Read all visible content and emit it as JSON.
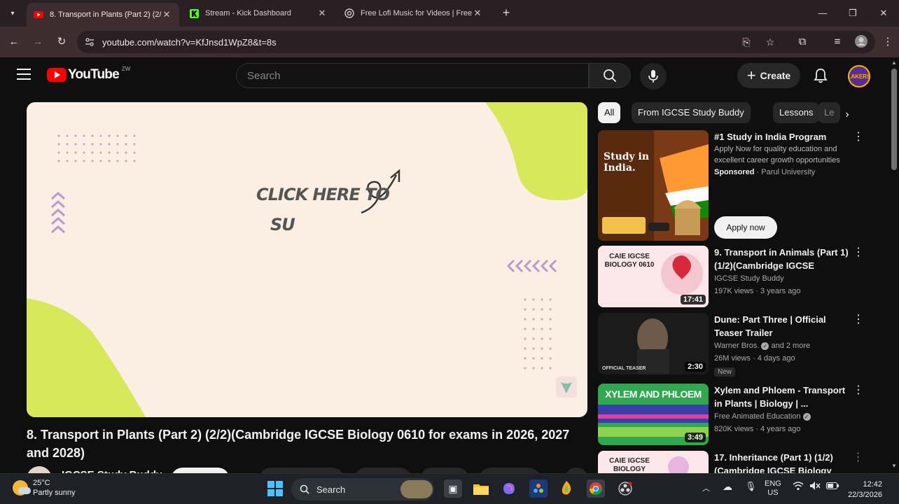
{
  "browser": {
    "tabs": [
      {
        "title": "8. Transport in Plants (Part 2) (2/2",
        "favicon": "youtube-icon",
        "active": true
      },
      {
        "title": "Stream - Kick Dashboard",
        "favicon": "kick-icon",
        "active": false
      },
      {
        "title": "Free Lofi Music for Videos | Free",
        "favicon": "lofi-icon",
        "active": false
      }
    ],
    "url": "youtube.com/watch?v=KfJnsd1WpZ8&t=8s"
  },
  "youtube": {
    "logo_text": "YouTube",
    "country_code": "ZW",
    "search_placeholder": "Search",
    "create_label": "Create",
    "avatar_text": "LAKERS"
  },
  "player": {
    "overlay_line1": "CLICK HERE TO",
    "overlay_line2": "SU"
  },
  "video": {
    "title": "8. Transport in Plants (Part 2) (2/2)(Cambridge IGCSE Biology 0610 for exams in 2026, 2027 and 2028)",
    "channel": "IGCSE Study Buddy"
  },
  "chips": [
    "All",
    "From IGCSE Study Buddy",
    "Lessons",
    "Le"
  ],
  "recommendations": [
    {
      "title": "#1 Study in India Program",
      "desc": "Apply Now for quality education and excellent career growth opportunities",
      "sponsored": "Sponsored",
      "advertiser": "Parul University",
      "cta": "Apply now",
      "thumb_text": "Study in India."
    },
    {
      "title": "9. Transport in Animals (Part 1) (1/2)(Cambridge IGCSE Biolog...",
      "channel": "IGCSE Study Buddy",
      "views": "197K views",
      "age": "3 years ago",
      "duration": "17:41",
      "thumb_text": "CAIE IGCSE BIOLOGY 0610"
    },
    {
      "title": "Dune: Part Three | Official Teaser Trailer",
      "channel": "Warner Bros.",
      "channel_extra": "and 2 more",
      "views": "26M views",
      "age": "4 days ago",
      "badge": "New",
      "duration": "2:30",
      "thumb_text": "OFFICIAL TEASER"
    },
    {
      "title": "Xylem and Phloem - Transport in Plants | Biology | ...",
      "channel": "Free Animated Education",
      "views": "820K views",
      "age": "4 years ago",
      "duration": "3:49",
      "thumb_text": "XYLEM AND PHLOEM"
    },
    {
      "title": "17. Inheritance (Part 1) (1/2) (Cambridge IGCSE Biology",
      "thumb_text": "CAIE IGCSE BIOLOGY"
    }
  ],
  "taskbar": {
    "temperature": "25°C",
    "weather": "Partly sunny",
    "search_label": "Search",
    "lang": "ENG",
    "region": "US",
    "time": "12:42",
    "date": "22/3/2026"
  },
  "colors": {
    "youtube_red": "#ff0000",
    "page_bg": "#0f0f0f",
    "thumb_bg": "#fbeee2",
    "thumb_accent": "#d7e85a"
  }
}
